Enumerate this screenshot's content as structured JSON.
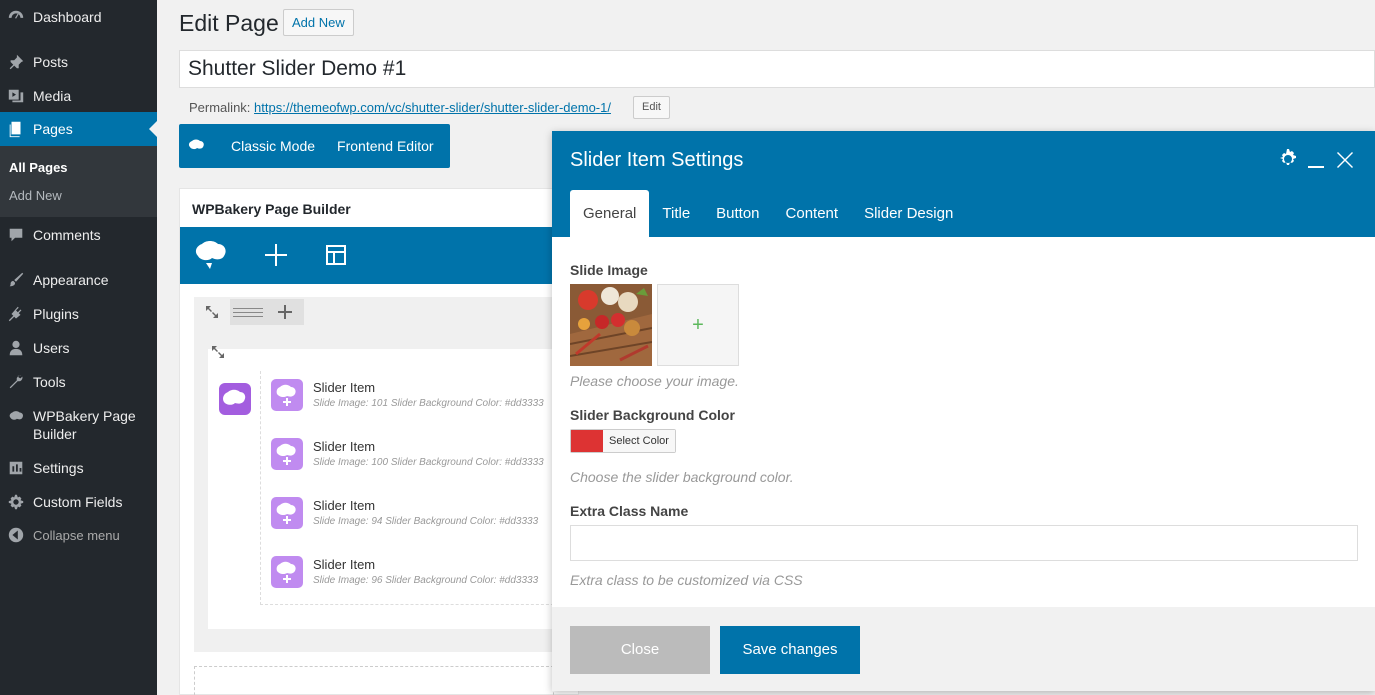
{
  "sidebar": {
    "items": [
      {
        "label": "Dashboard",
        "icon": "dashboard-icon"
      },
      {
        "label": "Posts",
        "icon": "pin-icon"
      },
      {
        "label": "Media",
        "icon": "media-icon"
      },
      {
        "label": "Pages",
        "icon": "pages-icon"
      },
      {
        "label": "Comments",
        "icon": "comments-icon"
      },
      {
        "label": "Appearance",
        "icon": "paintbrush-icon"
      },
      {
        "label": "Plugins",
        "icon": "plugin-icon"
      },
      {
        "label": "Users",
        "icon": "users-icon"
      },
      {
        "label": "Tools",
        "icon": "wrench-icon"
      },
      {
        "label": "WPBakery Page Builder",
        "icon": "wpbakery-icon"
      },
      {
        "label": "Settings",
        "icon": "settings-icon"
      },
      {
        "label": "Custom Fields",
        "icon": "gear-icon"
      },
      {
        "label": "Collapse menu",
        "icon": "collapse-icon"
      }
    ],
    "submenu": {
      "current": "All Pages",
      "other": "Add New"
    }
  },
  "header": {
    "title": "Edit Page",
    "add_new": "Add New"
  },
  "post": {
    "title": "Shutter Slider Demo #1",
    "permalink_label": "Permalink:",
    "permalink_base": "https://themeofwp.com/vc/shutter-slider/",
    "permalink_slug": "shutter-slider-demo-1/",
    "permalink_edit": "Edit"
  },
  "mode_bar": {
    "classic": "Classic Mode",
    "frontend": "Frontend Editor"
  },
  "builder": {
    "title": "WPBakery Page Builder",
    "items": [
      {
        "name": "Slider Item",
        "desc": "Slide Image: 101  Slider Background Color: #dd3333"
      },
      {
        "name": "Slider Item",
        "desc": "Slide Image: 100  Slider Background Color: #dd3333"
      },
      {
        "name": "Slider Item",
        "desc": "Slide Image: 94  Slider Background Color: #dd3333"
      },
      {
        "name": "Slider Item",
        "desc": "Slide Image: 96  Slider Background Color: #dd3333"
      }
    ]
  },
  "modal": {
    "title": "Slider Item Settings",
    "tabs": [
      "General",
      "Title",
      "Button",
      "Content",
      "Slider Design"
    ],
    "slide_image_label": "Slide Image",
    "slide_image_help": "Please choose your image.",
    "bg_color_label": "Slider Background Color",
    "bg_color_value": "#dd3333",
    "bg_color_button": "Select Color",
    "bg_color_help": "Choose the slider background color.",
    "class_label": "Extra Class Name",
    "class_value": "",
    "class_help": "Extra class to be customized via CSS",
    "close": "Close",
    "save": "Save changes"
  },
  "colors": {
    "accent": "#0073aa",
    "sidebar": "#23282d",
    "purple": "#a35ddf"
  }
}
